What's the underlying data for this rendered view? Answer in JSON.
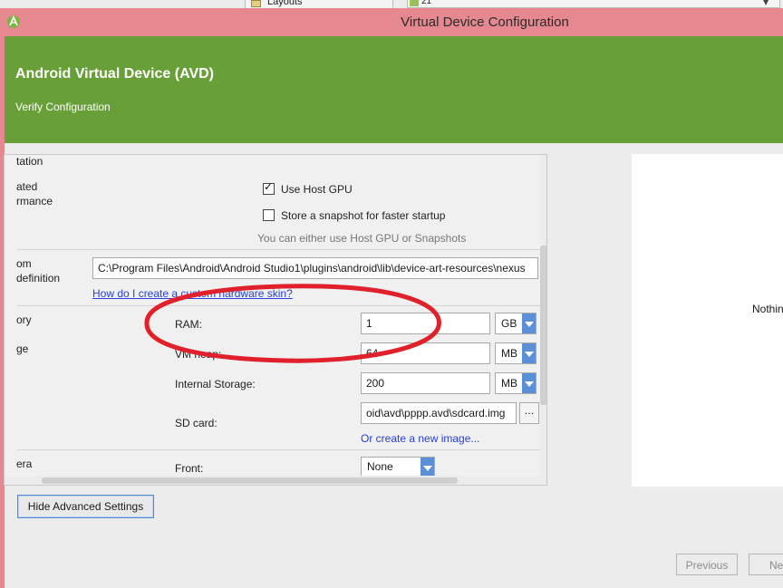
{
  "background_ide": {
    "tab_label": "Layouts",
    "api_combo_label": "21"
  },
  "window": {
    "title": "Virtual Device Configuration"
  },
  "header": {
    "title": "Android Virtual Device (AVD)",
    "subtitle": "Verify Configuration"
  },
  "panel": {
    "section_labels": {
      "orientation": "tation",
      "emulated_performance_1": "ated",
      "emulated_performance_2": "rmance",
      "custom_skin_1": "om",
      "custom_skin_2": "definition",
      "memory": "ory",
      "storage": "ge",
      "camera": "era"
    },
    "use_host_gpu": {
      "label": "Use Host GPU",
      "checked": true
    },
    "store_snapshot": {
      "label": "Store a snapshot for faster startup",
      "checked": false
    },
    "gpu_hint": "You can either use Host GPU or Snapshots",
    "skin_path": "C:\\Program Files\\Android\\Android Studio1\\plugins\\android\\lib\\device-art-resources\\nexus",
    "skin_link": "How do I create a custom hardware skin?",
    "ram": {
      "label": "RAM:",
      "value": "1",
      "unit": "GB"
    },
    "vm_heap": {
      "label": "VM heap:",
      "value": "64",
      "unit": "MB"
    },
    "internal_storage": {
      "label": "Internal Storage:",
      "value": "200",
      "unit": "MB"
    },
    "sd_card": {
      "label": "SD card:",
      "value": "oid\\avd\\pppp.avd\\sdcard.img",
      "browse": "...",
      "link": "Or create a new image..."
    },
    "front_camera": {
      "label": "Front:",
      "value": "None"
    }
  },
  "buttons": {
    "hide_advanced": "Hide Advanced Settings",
    "previous": "Previous",
    "next": "Next"
  },
  "preview": {
    "text": "Nothing"
  },
  "colors": {
    "title_bar": "#e5888f",
    "header": "#689f38",
    "annotation": "#e0202a",
    "link": "#2a40d8",
    "combo_button": "#5b8fd6"
  }
}
